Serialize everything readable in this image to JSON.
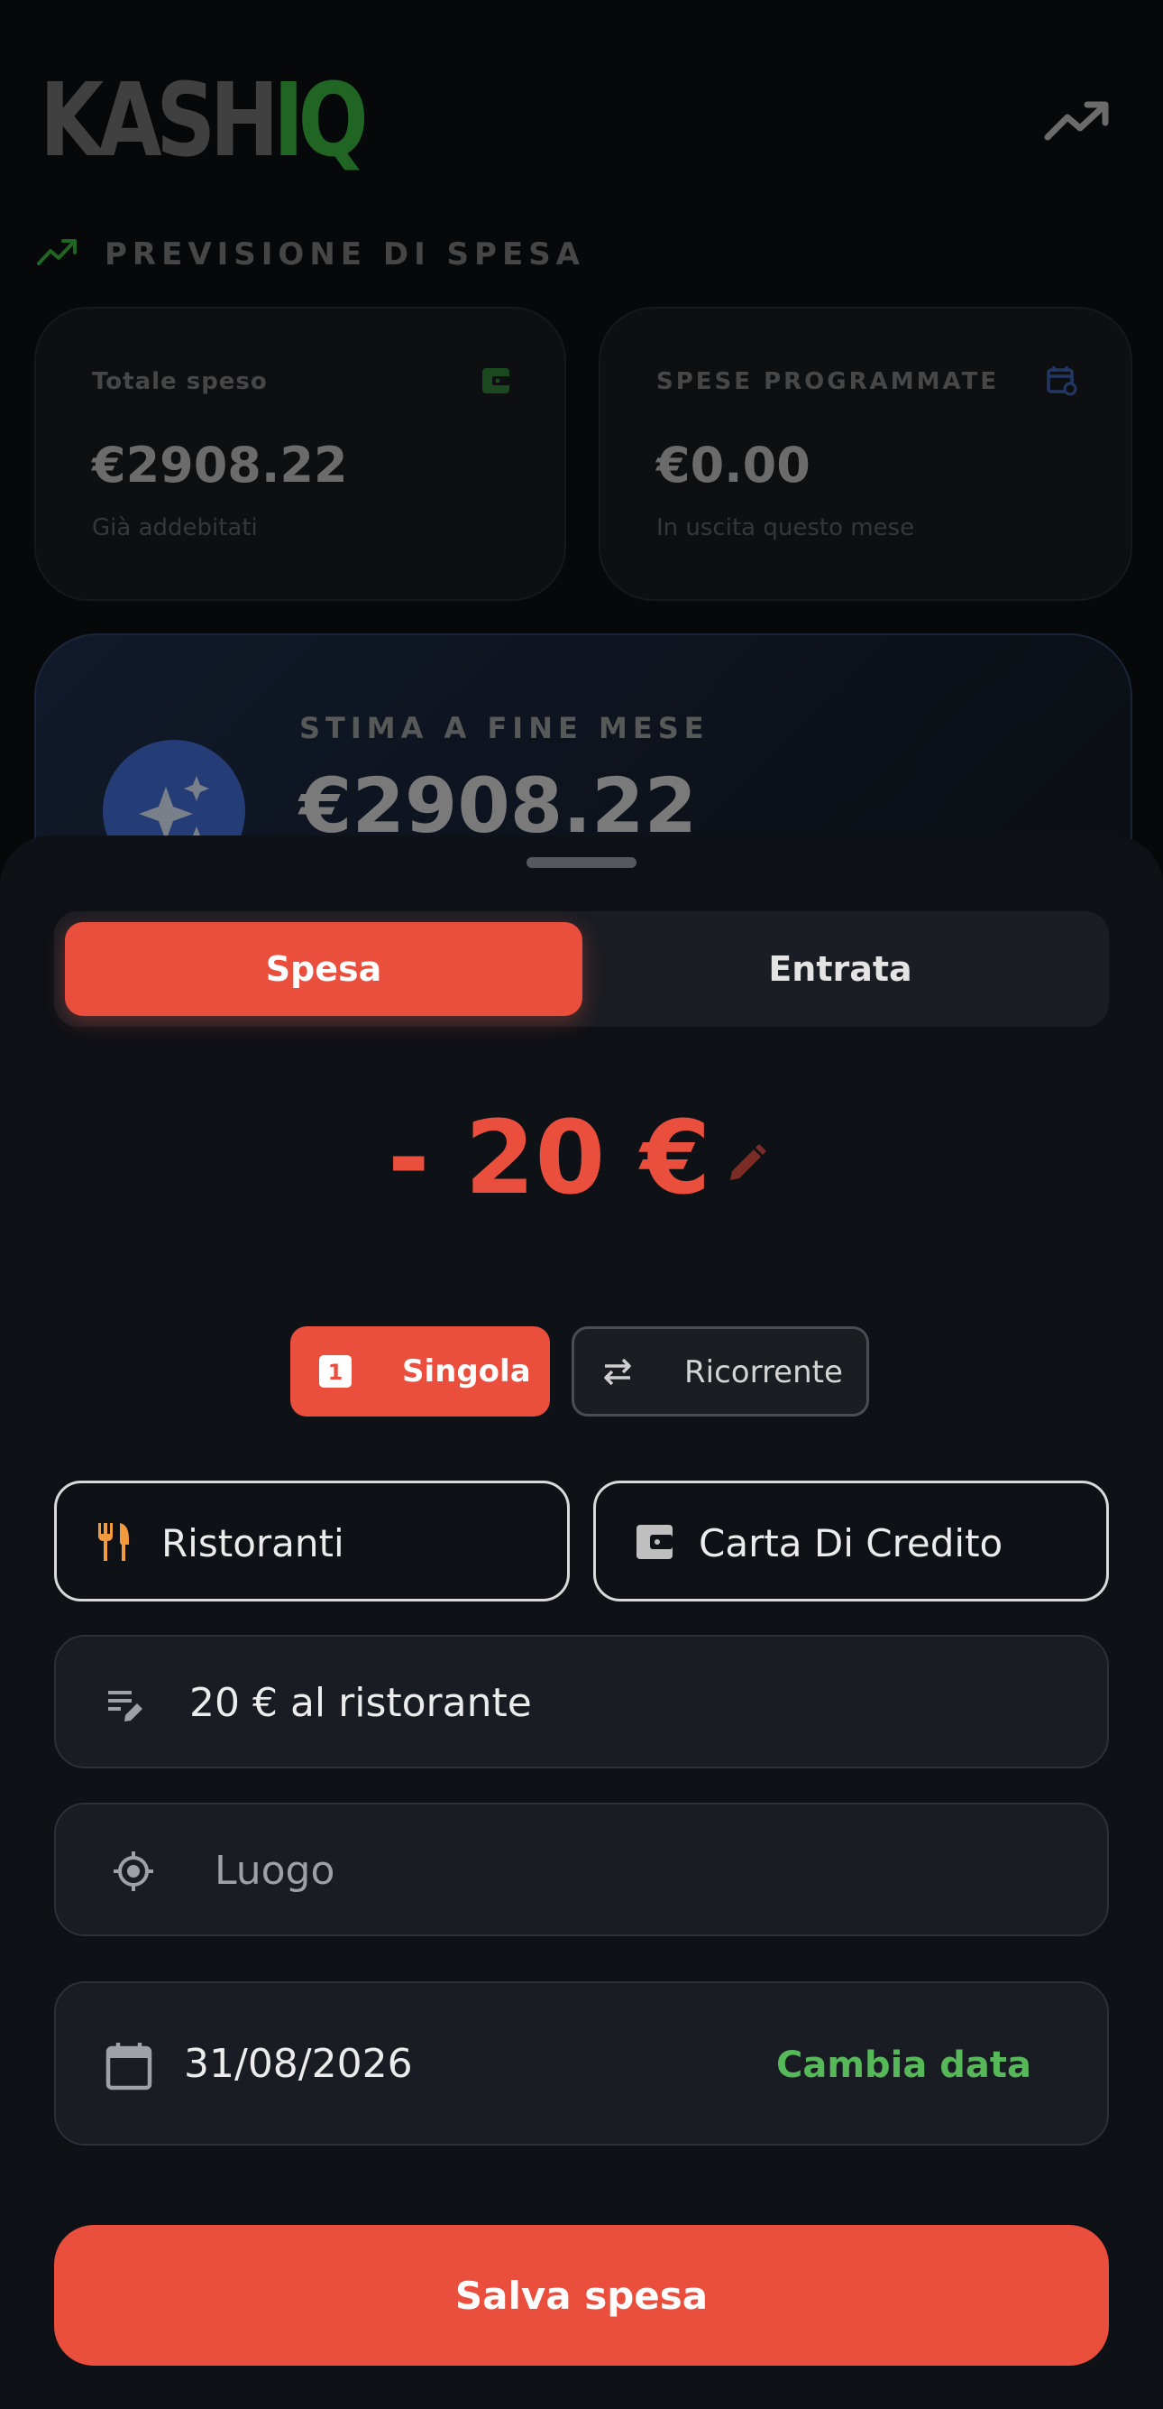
{
  "app": {
    "logo_part1": "KASH",
    "logo_part2": "IQ",
    "brand_color": "#35b23a"
  },
  "forecast": {
    "section_title": "PREVISIONE DI SPESA",
    "total_spent": {
      "label": "Totale speso",
      "value": "€2908.22",
      "subtitle": "Già addebitati"
    },
    "scheduled": {
      "label": "SPESE PROGRAMMATE",
      "value": "€0.00",
      "subtitle": "In uscita questo mese"
    },
    "estimate": {
      "label": "STIMA A FINE MESE",
      "value": "€2908.22"
    }
  },
  "sheet": {
    "tabs": {
      "expense": "Spesa",
      "income": "Entrata",
      "active": "expense"
    },
    "amount": "- 20 €",
    "types": {
      "single": "Singola",
      "single_icon_text": "1",
      "recurring": "Ricorrente",
      "active": "single"
    },
    "category": {
      "label": "Ristoranti",
      "icon": "fork-knife-icon"
    },
    "payment_method": {
      "label": "Carta Di Credito",
      "icon": "wallet-icon"
    },
    "description": {
      "value": "20 € al ristorante"
    },
    "location": {
      "placeholder": "Luogo"
    },
    "date": {
      "value": "31/08/2026",
      "change_label": "Cambia data"
    },
    "save_label": "Salva spesa",
    "accent_color": "#ea4e3d",
    "date_link_color": "#57b85a"
  }
}
